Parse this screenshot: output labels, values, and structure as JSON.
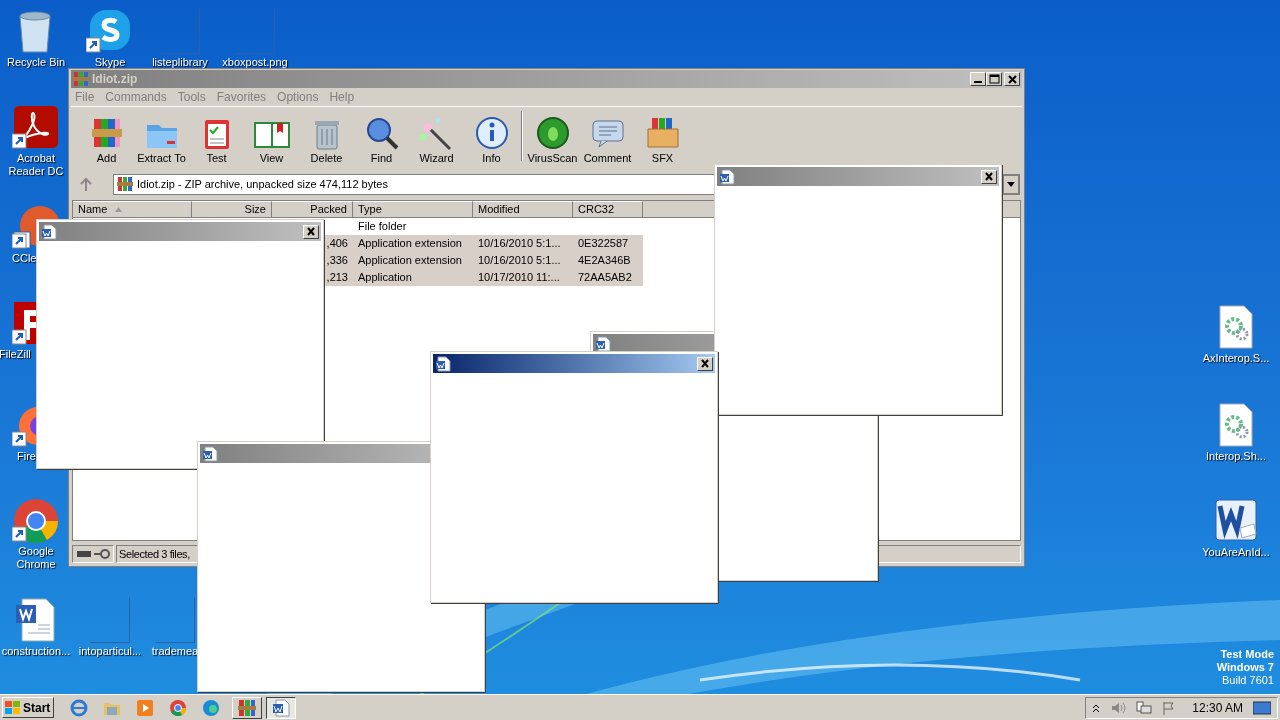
{
  "desktop_icons": [
    {
      "label": "Recycle Bin",
      "kind": "recycle"
    },
    {
      "label": "Skype",
      "kind": "skype"
    },
    {
      "label": "listeplibrary",
      "kind": "blank"
    },
    {
      "label": "xboxpost.png",
      "kind": "blank"
    },
    {
      "label": "Acrobat Reader DC",
      "kind": "pdf"
    },
    {
      "label": "CCle",
      "kind": "ccleaner"
    },
    {
      "label": "FileZill",
      "kind": "filezilla"
    },
    {
      "label": "Fire",
      "kind": "firefox"
    },
    {
      "label": "Google Chrome",
      "kind": "chrome"
    },
    {
      "label": "construction...",
      "kind": "worddoc"
    },
    {
      "label": "intoparticul...",
      "kind": "blank"
    },
    {
      "label": "trademea",
      "kind": "blank"
    },
    {
      "label": "AxInterop.S...",
      "kind": "geardoc"
    },
    {
      "label": "Interop.Sh...",
      "kind": "geardoc"
    },
    {
      "label": "YouAreAnId...",
      "kind": "word"
    }
  ],
  "os_notice": [
    "Test Mode",
    "Windows 7",
    "Build 7601"
  ],
  "window": {
    "title": "Idiot.zip",
    "active": false,
    "menu": [
      "File",
      "Commands",
      "Tools",
      "Favorites",
      "Options",
      "Help"
    ],
    "toolbar": [
      {
        "label": "Add",
        "kind": "add"
      },
      {
        "label": "Extract To",
        "kind": "extract"
      },
      {
        "label": "Test",
        "kind": "test"
      },
      {
        "label": "View",
        "kind": "view"
      },
      {
        "label": "Delete",
        "kind": "delete"
      },
      {
        "label": "Find",
        "kind": "find"
      },
      {
        "label": "Wizard",
        "kind": "wizard"
      },
      {
        "label": "Info",
        "kind": "info"
      },
      {
        "label": "VirusScan",
        "kind": "virus"
      },
      {
        "label": "Comment",
        "kind": "comment"
      },
      {
        "label": "SFX",
        "kind": "sfx"
      }
    ],
    "address": "Idiot.zip - ZIP archive, unpacked size 474,112 bytes",
    "columns": [
      {
        "label": "Name",
        "sorted": true
      },
      {
        "label": "Size",
        "sorted": false
      },
      {
        "label": "Packed",
        "sorted": false
      },
      {
        "label": "Type",
        "sorted": false
      },
      {
        "label": "Modified",
        "sorted": false
      },
      {
        "label": "CRC32",
        "sorted": false
      }
    ],
    "rows": [
      {
        "packed": "",
        "type": "File folder",
        "modified": "",
        "crc32": "",
        "selected": false
      },
      {
        "packed": ",406",
        "type": "Application extension",
        "modified": "10/16/2010 5:1...",
        "crc32": "0E322587",
        "selected": true
      },
      {
        "packed": ",336",
        "type": "Application extension",
        "modified": "10/16/2010 5:1...",
        "crc32": "4E2A346B",
        "selected": true
      },
      {
        "packed": ",213",
        "type": "Application",
        "modified": "10/17/2010 11:...",
        "crc32": "72AA5AB2",
        "selected": true
      }
    ],
    "status": "Selected 3 files,"
  },
  "popups": [
    {
      "active": false,
      "has_close": true
    },
    {
      "active": false
    },
    {
      "active": false
    },
    {
      "active": false,
      "has_close": true
    },
    {
      "active": true,
      "has_close": true
    }
  ],
  "taskbar": {
    "start": "Start",
    "quick_launch": [
      {
        "kind": "ie"
      },
      {
        "kind": "folder"
      },
      {
        "kind": "media"
      },
      {
        "kind": "chrome"
      },
      {
        "kind": "edge"
      }
    ],
    "tasks": [
      {
        "kind": "winrar",
        "selected": false
      },
      {
        "kind": "word",
        "selected": true
      }
    ],
    "clock": "12:30 AM"
  }
}
